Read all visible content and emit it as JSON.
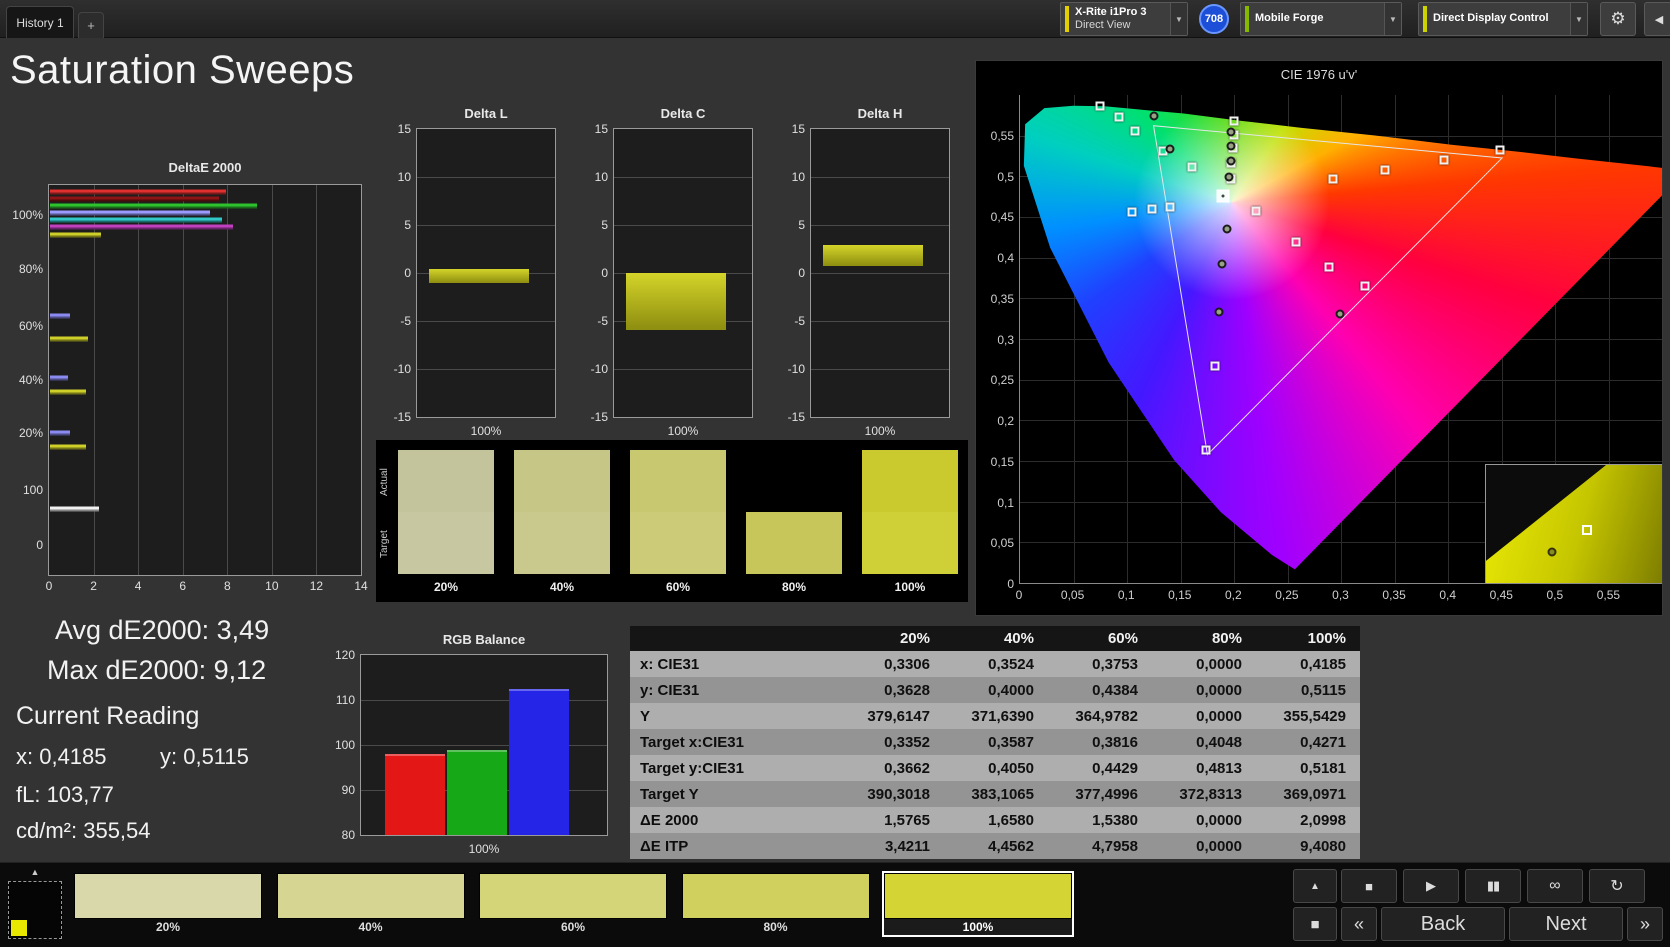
{
  "colors": {
    "accent_meter": "#e3cf00",
    "accent_source": "#86b800",
    "accent_display": "#ccd400",
    "badge_blue": "#1c4ed8",
    "olive_bar": "#c6c61e"
  },
  "top_bar": {
    "history_tab": "History 1",
    "add_tab": "+",
    "meter_line1": "X-Rite i1Pro 3",
    "meter_line2": "Direct View",
    "badge": "708",
    "source": "Mobile Forge",
    "display_control": "Direct Display Control",
    "dropdown_glyph": "▼",
    "gear_glyph": "⚙",
    "collapse_glyph": "◀"
  },
  "page_title": "Saturation Sweeps",
  "deltae_chart": {
    "title": "DeltaE 2000",
    "x_ticks": [
      "0",
      "2",
      "4",
      "6",
      "8",
      "10",
      "12",
      "14"
    ],
    "x_max": 14,
    "y_labels": [
      {
        "text": "100%",
        "pos": 7.7
      },
      {
        "text": "80%",
        "pos": 21.5
      },
      {
        "text": "60%",
        "pos": 36.1
      },
      {
        "text": "40%",
        "pos": 49.9
      },
      {
        "text": "20%",
        "pos": 63.7
      },
      {
        "text": "100",
        "pos": 78.3
      },
      {
        "text": "0",
        "pos": 92.3
      }
    ],
    "bars": [
      {
        "color": "#e03030",
        "value": 7.9,
        "pos": 1.8
      },
      {
        "color": "#8d1515",
        "value": 7.6,
        "pos": 3.6
      },
      {
        "color": "#2ec22e",
        "value": 9.3,
        "pos": 5.4
      },
      {
        "color": "#9a9aff",
        "value": 7.2,
        "pos": 7.2
      },
      {
        "color": "#30c8c8",
        "value": 7.7,
        "pos": 9.0
      },
      {
        "color": "#c040c0",
        "value": 8.2,
        "pos": 10.8
      },
      {
        "color": "#cfcf2a",
        "value": 2.3,
        "pos": 12.8
      },
      {
        "color": "#8a8af0",
        "value": 0.9,
        "pos": 33.5
      },
      {
        "color": "#cfcf2a",
        "value": 1.7,
        "pos": 39.4
      },
      {
        "color": "#8a8af0",
        "value": 0.8,
        "pos": 49.6
      },
      {
        "color": "#cfcf2a",
        "value": 1.6,
        "pos": 53.2
      },
      {
        "color": "#8a8af0",
        "value": 0.9,
        "pos": 63.7
      },
      {
        "color": "#cfcf2a",
        "value": 1.6,
        "pos": 67.3
      },
      {
        "color": "#f0f0f0",
        "value": 2.2,
        "pos": 83.1
      }
    ]
  },
  "delta_axis": {
    "min": -15,
    "max": 15,
    "ticks": [
      15,
      10,
      5,
      0,
      -5,
      -10,
      -15
    ]
  },
  "delta_charts": [
    {
      "title": "Delta L",
      "from": -1.0,
      "to": 0.4,
      "x_label": "100%"
    },
    {
      "title": "Delta C",
      "from": -5.9,
      "to": 0.0,
      "x_label": "100%"
    },
    {
      "title": "Delta H",
      "from": 0.7,
      "to": 2.9,
      "x_label": "100%"
    }
  ],
  "swatch_strip": {
    "row_labels": [
      "Actual",
      "Target"
    ],
    "swatches": [
      {
        "label": "20%",
        "actual": "#c3c39c",
        "target": "#c7c7a2"
      },
      {
        "label": "40%",
        "actual": "#c6c687",
        "target": "#c9c98d"
      },
      {
        "label": "60%",
        "actual": "#c8c870",
        "target": "#cbcb78"
      },
      {
        "label": "80%",
        "actual": "#000000",
        "target": "#c6c65a"
      },
      {
        "label": "100%",
        "actual": "#caca2e",
        "target": "#cfcf38"
      }
    ]
  },
  "cie_chart": {
    "title": "CIE 1976 u'v'",
    "axis_max": 0.6,
    "tick_step": 0.05,
    "x_ticks": [
      "0",
      "0,05",
      "0,1",
      "0,15",
      "0,2",
      "0,25",
      "0,3",
      "0,35",
      "0,4",
      "0,45",
      "0,5",
      "0,55"
    ],
    "y_ticks": [
      "0",
      "0,05",
      "0,1",
      "0,15",
      "0,2",
      "0,25",
      "0,3",
      "0,35",
      "0,4",
      "0,45",
      "0,5",
      "0,55"
    ],
    "gamut_triangle": [
      [
        75.1,
        12.9
      ],
      [
        20.8,
        6.3
      ],
      [
        29.2,
        73.7
      ]
    ],
    "squares": [
      [
        12.4,
        2.2
      ],
      [
        15.4,
        4.6
      ],
      [
        17.9,
        7.4
      ],
      [
        22.2,
        11.5
      ],
      [
        26.8,
        14.8
      ],
      [
        33.3,
        5.4
      ],
      [
        33.3,
        8.1
      ],
      [
        33.1,
        10.9
      ],
      [
        32.9,
        13.9
      ],
      [
        32.8,
        17.2
      ],
      [
        17.5,
        24.0
      ],
      [
        20.5,
        23.3
      ],
      [
        23.3,
        22.9
      ],
      [
        36.8,
        23.7
      ],
      [
        43.0,
        30.1
      ],
      [
        48.2,
        35.3
      ],
      [
        53.8,
        39.2
      ],
      [
        48.7,
        17.2
      ],
      [
        56.8,
        15.3
      ],
      [
        66.1,
        13.3
      ],
      [
        74.8,
        11.3
      ],
      [
        30.3,
        55.6
      ],
      [
        29.0,
        72.8
      ]
    ],
    "dots": [
      [
        20.9,
        4.4
      ],
      [
        23.3,
        11.1
      ],
      [
        32.9,
        7.6
      ],
      [
        32.9,
        10.5
      ],
      [
        32.8,
        13.5
      ],
      [
        32.6,
        16.8
      ],
      [
        32.3,
        27.5
      ],
      [
        31.5,
        34.6
      ],
      [
        31.0,
        44.4
      ],
      [
        49.8,
        44.9
      ]
    ],
    "current_square": [
      31.6,
      20.7
    ],
    "inset_markers": {
      "dot": [
        32,
        62
      ],
      "square": [
        49,
        46
      ]
    }
  },
  "readings": {
    "avg": "Avg dE2000: 3,49",
    "max": "Max dE2000: 9,12",
    "current_heading": "Current Reading",
    "x": "x: 0,4185",
    "y": "y: 0,5115",
    "fl": "fL: 103,77",
    "cdm2": "cd/m²: 355,54"
  },
  "rgb_balance": {
    "title": "RGB Balance",
    "y_min": 80,
    "y_max": 120,
    "y_ticks": [
      120,
      110,
      100,
      90,
      80
    ],
    "bars": [
      {
        "name": "red",
        "color": "#e41717",
        "value": 98
      },
      {
        "name": "green",
        "color": "#17a817",
        "value": 99
      },
      {
        "name": "blue",
        "color": "#2525e8",
        "value": 112.5
      }
    ],
    "x_label": "100%"
  },
  "table": {
    "headers": [
      "",
      "20%",
      "40%",
      "60%",
      "80%",
      "100%"
    ],
    "rows": [
      {
        "label": "x: CIE31",
        "values": [
          "0,3306",
          "0,3524",
          "0,3753",
          "0,0000",
          "0,4185"
        ]
      },
      {
        "label": "y: CIE31",
        "values": [
          "0,3628",
          "0,4000",
          "0,4384",
          "0,0000",
          "0,5115"
        ]
      },
      {
        "label": "Y",
        "values": [
          "379,6147",
          "371,6390",
          "364,9782",
          "0,0000",
          "355,5429"
        ]
      },
      {
        "label": "Target x:CIE31",
        "values": [
          "0,3352",
          "0,3587",
          "0,3816",
          "0,4048",
          "0,4271"
        ]
      },
      {
        "label": "Target y:CIE31",
        "values": [
          "0,3662",
          "0,4050",
          "0,4429",
          "0,4813",
          "0,5181"
        ]
      },
      {
        "label": "Target Y",
        "values": [
          "390,3018",
          "383,1065",
          "377,4996",
          "372,8313",
          "369,0971"
        ]
      },
      {
        "label": "ΔE 2000",
        "values": [
          "1,5765",
          "1,6580",
          "1,5380",
          "0,0000",
          "2,0998"
        ]
      },
      {
        "label": "ΔE ITP",
        "values": [
          "3,4211",
          "4,4562",
          "4,7958",
          "0,0000",
          "9,4080"
        ]
      }
    ]
  },
  "patch_bar": {
    "patches": [
      {
        "label": "20%",
        "color": "#d8d8aa",
        "active": false
      },
      {
        "label": "40%",
        "color": "#d6d692",
        "active": false
      },
      {
        "label": "60%",
        "color": "#d4d478",
        "active": false
      },
      {
        "label": "80%",
        "color": "#d0d05e",
        "active": false
      },
      {
        "label": "100%",
        "color": "#d4d435",
        "active": true
      }
    ],
    "controls": {
      "up": "▲",
      "window": "■",
      "stop": "■",
      "play": "▶",
      "pause": "▮▮",
      "loop": "∞",
      "refresh": "↻",
      "back_chevron": "«",
      "back": "Back",
      "next": "Next",
      "next_chevron": "»"
    }
  }
}
